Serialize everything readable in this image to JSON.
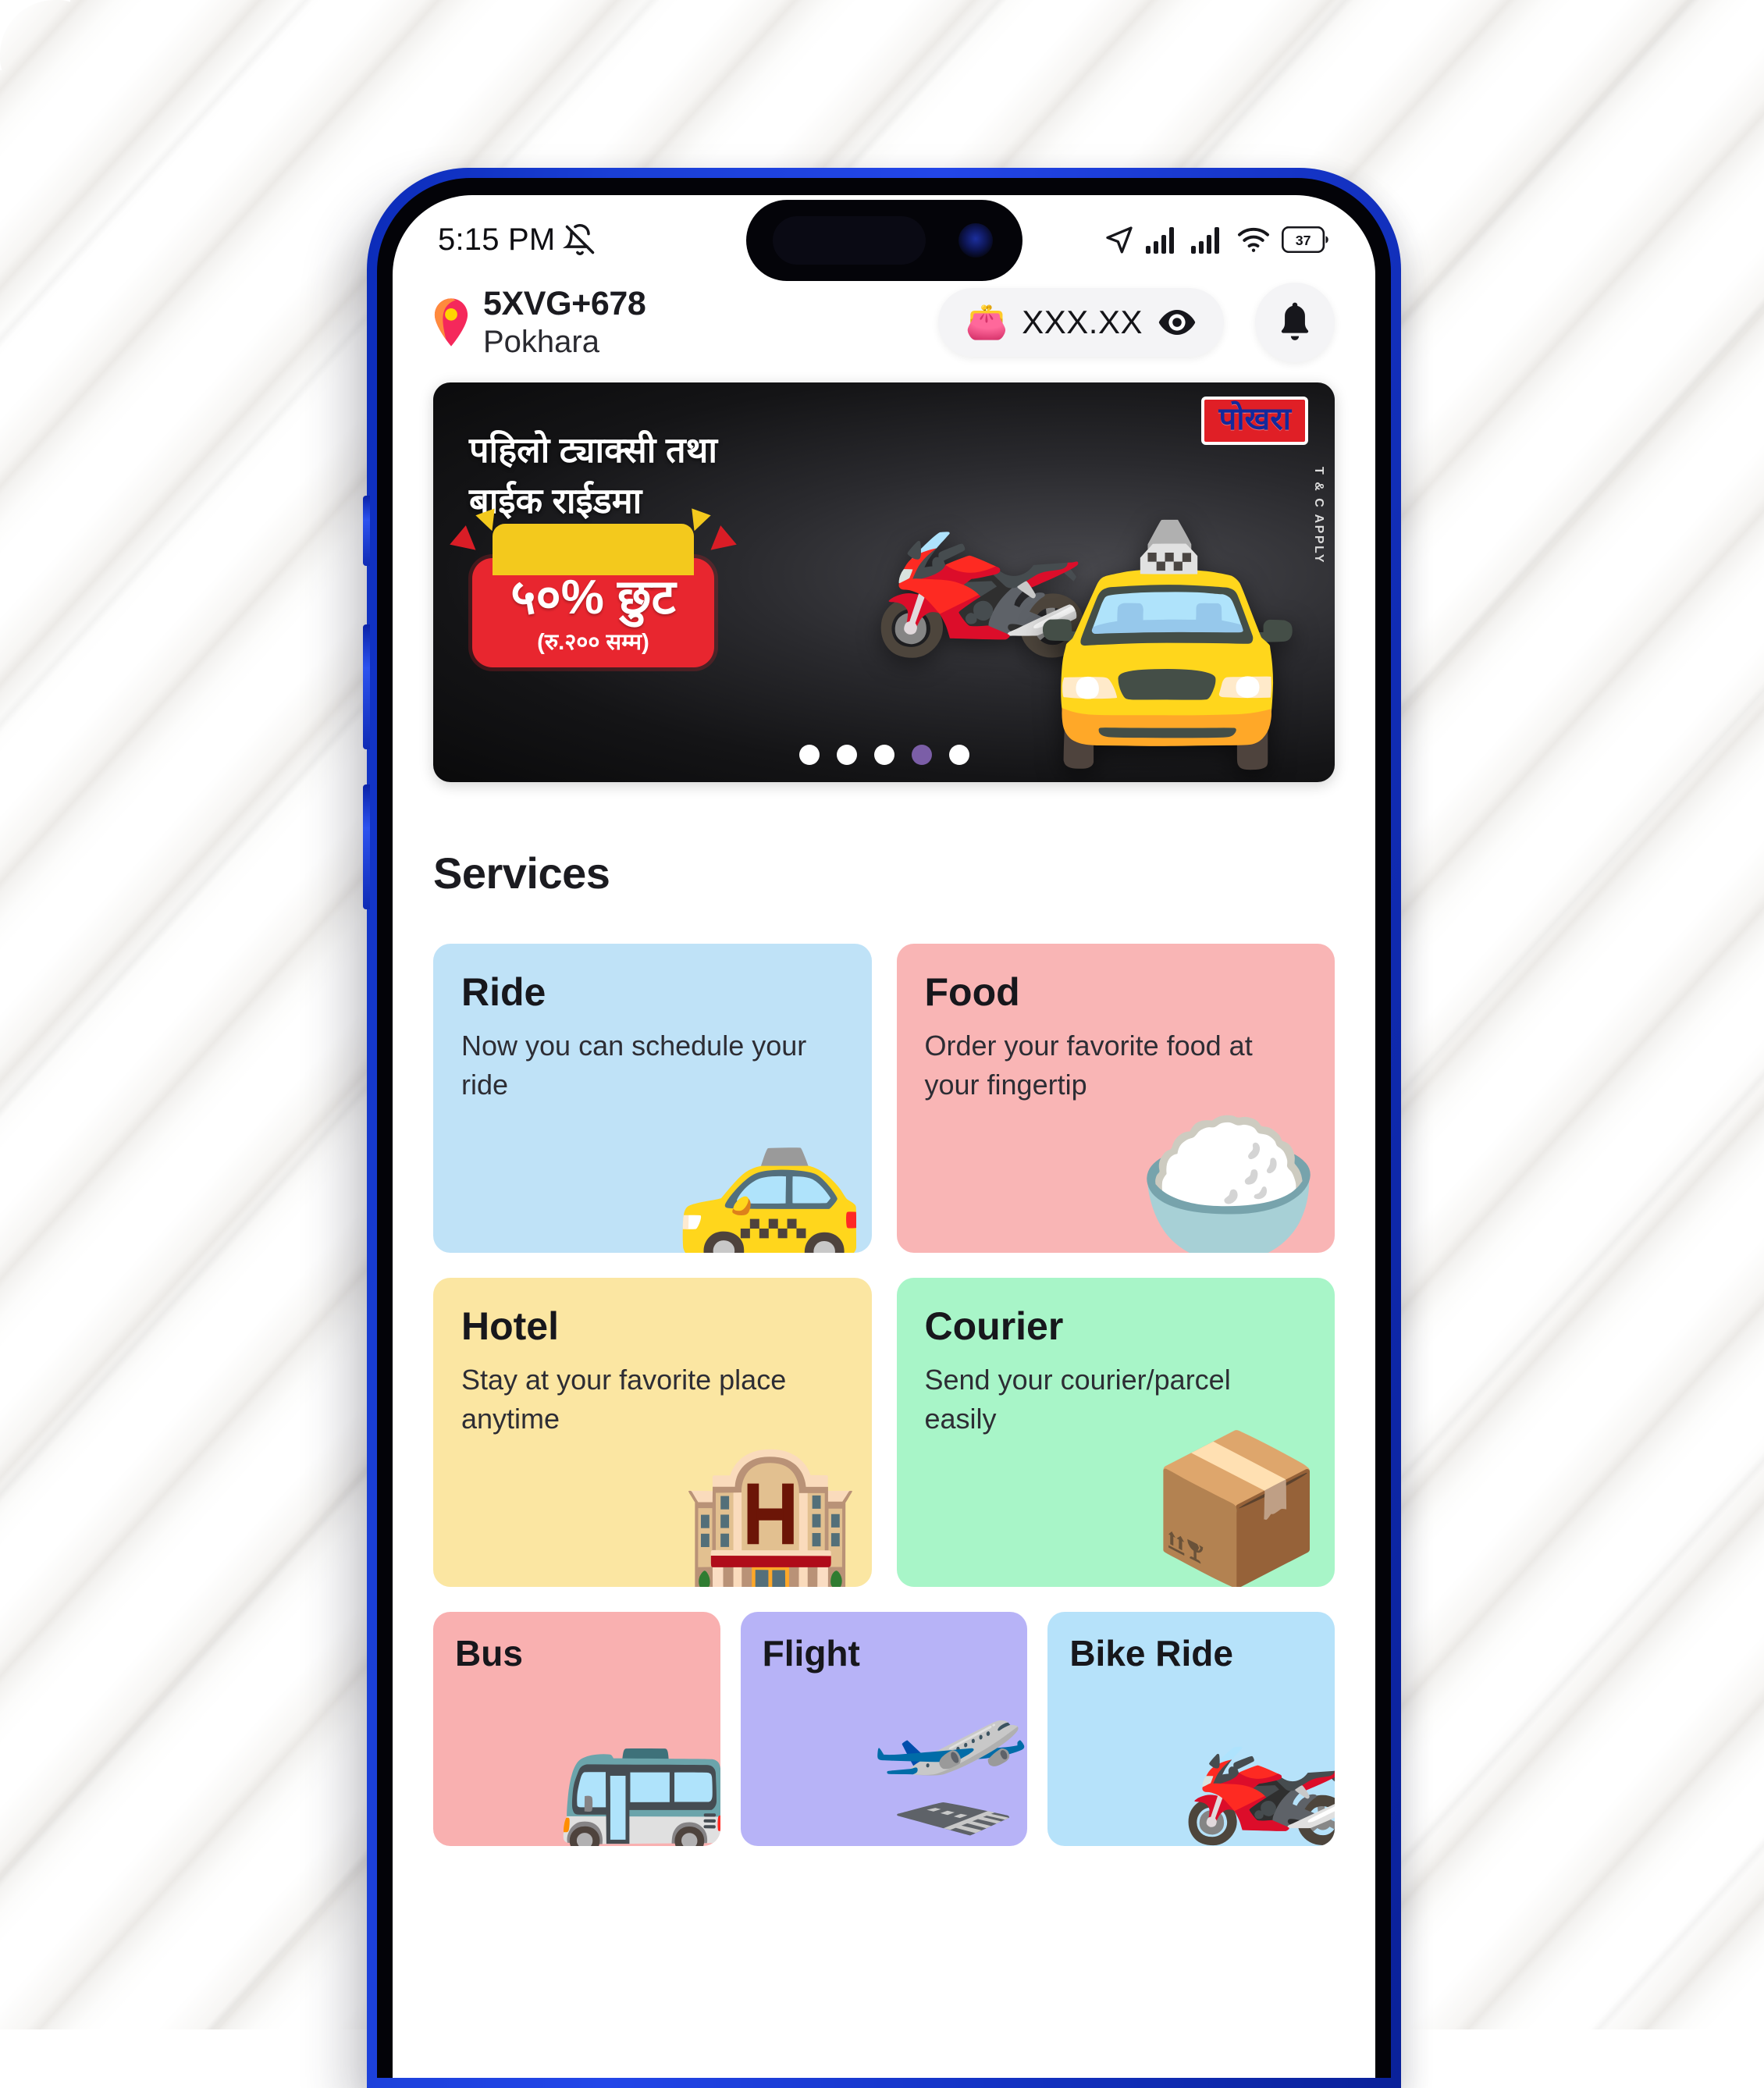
{
  "status_bar": {
    "time": "5:15 PM",
    "mute_icon": "bell-slash-icon",
    "location_icon": "location-arrow-icon",
    "signal_1_icon": "signal-bars-icon",
    "signal_2_icon": "signal-bars-icon",
    "wifi_icon": "wifi-icon",
    "battery_level": "37"
  },
  "header": {
    "pin_icon": "location-pin-icon",
    "plus_code": "5XVG+678",
    "city": "Pokhara",
    "wallet_icon": "wallet-emoji",
    "wallet_amount": "XXX.XX",
    "eye_icon": "eye-icon",
    "bell_icon": "bell-icon"
  },
  "banner": {
    "badge": "पोखरा",
    "tc": "T & C APPLY",
    "title_line1": "पहिलो ट्याक्सी तथा",
    "title_line2": "बाईक राईडमा",
    "discount": "५०% छुट",
    "discount_note": "(रु.२०० सम्म)",
    "rider_icon": "motorcycle-rider-emoji",
    "taxi_icon": "taxi-car-emoji",
    "dots_total": 5,
    "dot_active_index": 3,
    "dot_active_color": "#7b5ea7"
  },
  "services": {
    "title": "Services",
    "cards": [
      {
        "name": "Ride",
        "desc": "Now you can schedule your ride",
        "bg": "#bfe2f7",
        "emoji": "🚕",
        "icon_name": "taxi-icon"
      },
      {
        "name": "Food",
        "desc": "Order your favorite food at your fingertip",
        "bg": "#f9b5b5",
        "emoji": "🍚",
        "icon_name": "rice-bowl-icon"
      },
      {
        "name": "Hotel",
        "desc": "Stay at your favorite place anytime",
        "bg": "#fbe6a2",
        "emoji": "🏨",
        "icon_name": "hotel-building-icon"
      },
      {
        "name": "Courier",
        "desc": "Send your courier/parcel easily",
        "bg": "#a8f5c8",
        "emoji": "📦",
        "icon_name": "parcel-boxes-icon"
      }
    ],
    "mini_cards": [
      {
        "name": "Bus",
        "bg": "#f9b0b0",
        "emoji": "🚌",
        "icon_name": "bus-icon"
      },
      {
        "name": "Flight",
        "bg": "#b7b3f7",
        "emoji": "🛫",
        "icon_name": "airplane-icon"
      },
      {
        "name": "Bike Ride",
        "bg": "#b6e2fa",
        "emoji": "🏍️",
        "icon_name": "motorcycle-icon"
      }
    ]
  }
}
